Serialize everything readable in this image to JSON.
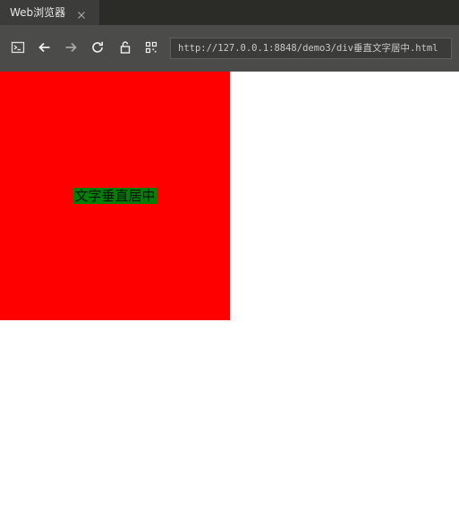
{
  "browser": {
    "tab_title": "Web浏览器",
    "address": "http://127.0.0.1:8848/demo3/div垂直文字居中.html",
    "toolbar_icons": [
      "terminal-icon",
      "back-arrow-icon",
      "forward-arrow-icon",
      "reload-icon",
      "lock-icon",
      "qr-code-icon",
      "close-icon"
    ]
  },
  "page": {
    "box_color": "#ff0000",
    "text_bg_color": "#008000",
    "text": "文字垂直居中"
  }
}
